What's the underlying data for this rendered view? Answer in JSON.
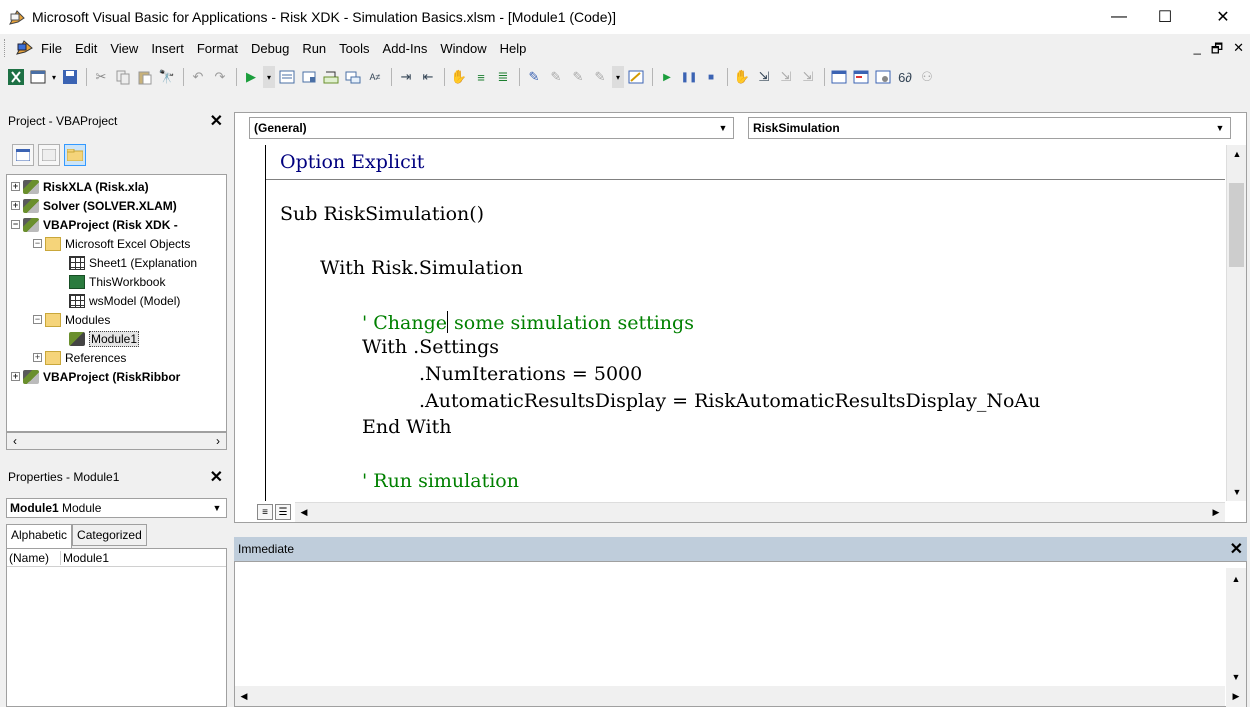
{
  "window": {
    "title": "Microsoft Visual Basic for Applications - Risk XDK - Simulation Basics.xlsm - [Module1 (Code)]",
    "minimize": "—",
    "maximize": "☐",
    "close": "✕"
  },
  "menubar": {
    "items": [
      "File",
      "Edit",
      "View",
      "Insert",
      "Format",
      "Debug",
      "Run",
      "Tools",
      "Add-Ins",
      "Window",
      "Help"
    ],
    "right_controls": [
      "_",
      "🗗",
      "✕"
    ]
  },
  "toolbar": {
    "icons": [
      "excel-icon",
      "insert-userform-icon",
      "save-icon",
      "cut-icon",
      "copy-icon",
      "paste-icon",
      "find-icon",
      "undo-icon",
      "redo-icon",
      "run-icon",
      "list-properties-icon",
      "toggle-breakpoint-icon",
      "comment-block-icon",
      "design-mode-icon",
      "break-icon",
      "reset-icon"
    ]
  },
  "project_pane": {
    "title": "Project - VBAProject",
    "tree": [
      {
        "label": "RiskXLA (Risk.xla)",
        "bold": true,
        "level": 0,
        "icon": "project"
      },
      {
        "label": "Solver (SOLVER.XLAM)",
        "bold": true,
        "level": 0,
        "icon": "project"
      },
      {
        "label": "VBAProject (Risk XDK -",
        "bold": true,
        "level": 0,
        "icon": "project"
      },
      {
        "label": "Microsoft Excel Objects",
        "bold": false,
        "level": 1,
        "icon": "folder"
      },
      {
        "label": "Sheet1 (Explanation",
        "bold": false,
        "level": 2,
        "icon": "sheet"
      },
      {
        "label": "ThisWorkbook",
        "bold": false,
        "level": 2,
        "icon": "workbook"
      },
      {
        "label": "wsModel (Model)",
        "bold": false,
        "level": 2,
        "icon": "sheet"
      },
      {
        "label": "Modules",
        "bold": false,
        "level": 1,
        "icon": "folder"
      },
      {
        "label": "Module1",
        "bold": false,
        "level": 2,
        "icon": "module"
      },
      {
        "label": "References",
        "bold": false,
        "level": 1,
        "icon": "folder"
      },
      {
        "label": "VBAProject (RiskRibbor",
        "bold": true,
        "level": 0,
        "icon": "project"
      }
    ]
  },
  "properties_pane": {
    "title": "Properties - Module1",
    "object_name": "Module1",
    "object_type": "Module",
    "tabs": [
      "Alphabetic",
      "Categorized"
    ],
    "rows": [
      {
        "key": "(Name)",
        "value": "Module1"
      }
    ]
  },
  "code_window": {
    "object_combo": "(General)",
    "procedure_combo": "RiskSimulation",
    "lines": {
      "l1": "Option Explicit",
      "l2": "Sub RiskSimulation()",
      "l3": "With Risk.Simulation",
      "l4a": "' Change",
      "l4b": " some simulation settings",
      "l5": "With .Settings",
      "l6": ".NumIterations = 5000",
      "l7": ".AutomaticResultsDisplay = RiskAutomaticResultsDisplay_NoAu",
      "l8": "End With",
      "l9": "' Run simulation"
    }
  },
  "immediate_window": {
    "title": "Immediate"
  }
}
